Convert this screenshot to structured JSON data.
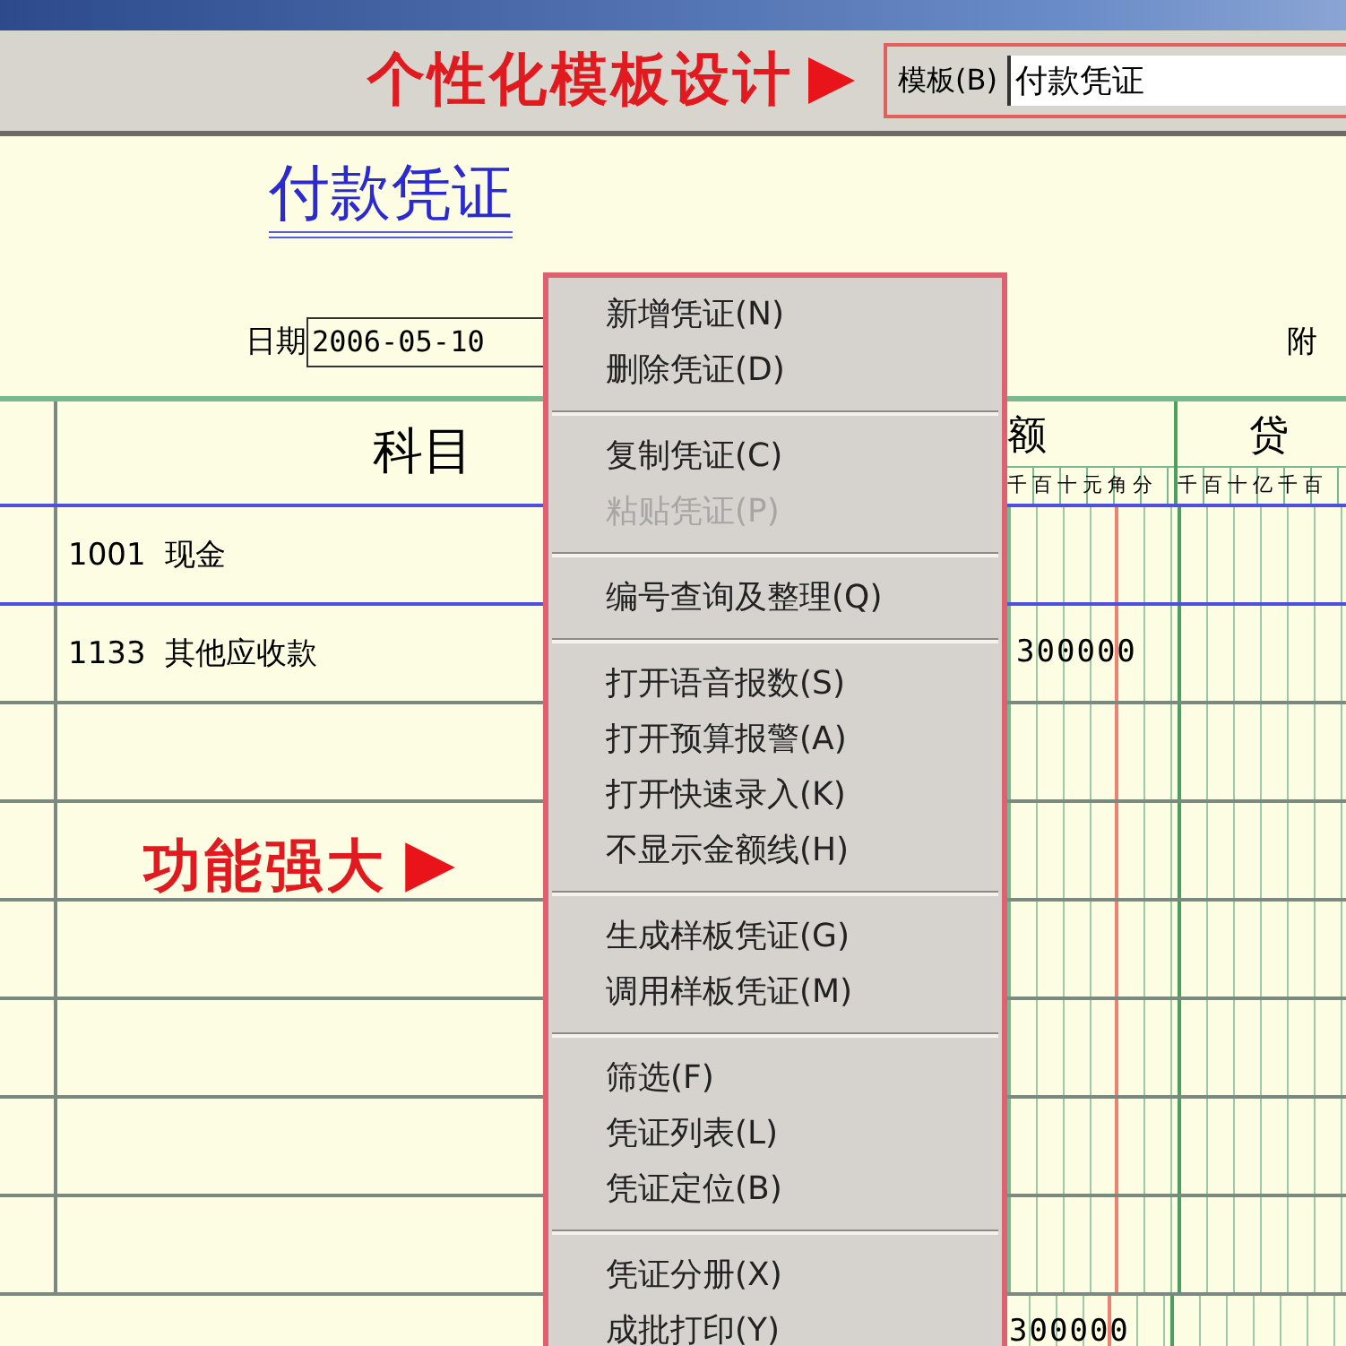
{
  "toolbar": {
    "annotation": "个性化模板设计",
    "template_field": {
      "label": "模板(B)",
      "value": "付款凭证"
    }
  },
  "voucher": {
    "title": "付款凭证",
    "date": {
      "label": "日期",
      "value": "2006-05-10"
    },
    "attachments_label": "附",
    "table": {
      "columns": [
        "科目",
        "额",
        "贷"
      ],
      "debit_digits": "千百十元角分",
      "credit_digits": "千百十亿千百",
      "rows": [
        {
          "account": "1001  现金"
        },
        {
          "account": "1133  其他应收款",
          "debit": "300000"
        },
        {},
        {},
        {},
        {},
        {},
        {}
      ],
      "total": {
        "debit": "300000"
      }
    }
  },
  "annotation": "功能强大",
  "context_menu": {
    "groups": [
      [
        {
          "label": "新增凭证(N)",
          "disabled": false
        },
        {
          "label": "删除凭证(D)",
          "disabled": false
        }
      ],
      [
        {
          "label": "复制凭证(C)",
          "disabled": false
        },
        {
          "label": "粘贴凭证(P)",
          "disabled": true
        }
      ],
      [
        {
          "label": "编号查询及整理(Q)",
          "disabled": false
        }
      ],
      [
        {
          "label": "打开语音报数(S)",
          "disabled": false
        },
        {
          "label": "打开预算报警(A)",
          "disabled": false
        },
        {
          "label": "打开快速录入(K)",
          "disabled": false
        },
        {
          "label": "不显示金额线(H)",
          "disabled": false
        }
      ],
      [
        {
          "label": "生成样板凭证(G)",
          "disabled": false
        },
        {
          "label": "调用样板凭证(M)",
          "disabled": false
        }
      ],
      [
        {
          "label": "筛选(F)",
          "disabled": false
        },
        {
          "label": "凭证列表(L)",
          "disabled": false
        },
        {
          "label": "凭证定位(B)",
          "disabled": false
        }
      ],
      [
        {
          "label": "凭证分册(X)",
          "disabled": false
        },
        {
          "label": "成批打印(Y)",
          "disabled": false
        }
      ]
    ]
  }
}
